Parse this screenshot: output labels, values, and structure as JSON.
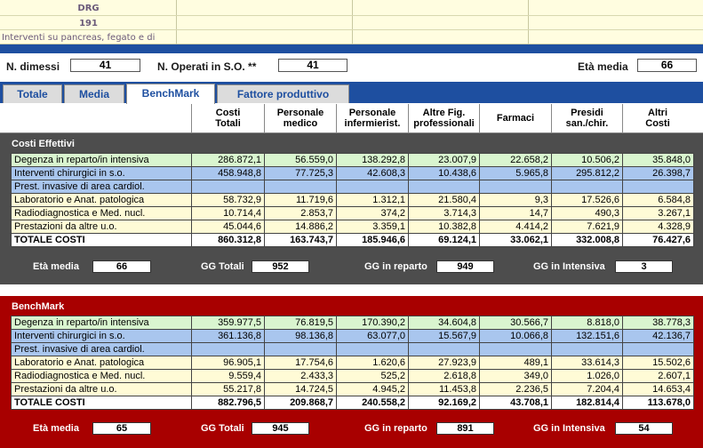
{
  "drg": {
    "title": "DRG",
    "code": "191",
    "description": "Interventi su pancreas, fegato e di"
  },
  "counters": {
    "dimessi_label": "N. dimessi",
    "dimessi_value": "41",
    "operati_label": "N. Operati in S.O. **",
    "operati_value": "41",
    "eta_label": "Età media",
    "eta_value": "66"
  },
  "tabs": [
    {
      "label": "Totale",
      "active": false
    },
    {
      "label": "Media",
      "active": false
    },
    {
      "label": "BenchMark",
      "active": true
    },
    {
      "label": "Fattore produttivo",
      "active": false
    }
  ],
  "columns": [
    "Costi\nTotali",
    "Personale\nmedico",
    "Personale\ninfermierist.",
    "Altre Fig.\nprofessionali",
    "Farmaci",
    "Presidi\nsan./chir.",
    "Altri\nCosti"
  ],
  "costi_effettivi": {
    "title": "Costi Effettivi",
    "rows": [
      {
        "name": "Degenza in reparto/in intensiva",
        "color": "green",
        "values": [
          "286.872,1",
          "56.559,0",
          "138.292,8",
          "23.007,9",
          "22.658,2",
          "10.506,2",
          "35.848,0"
        ]
      },
      {
        "name": "Interventi chirurgici in s.o.",
        "color": "blue",
        "values": [
          "458.948,8",
          "77.725,3",
          "42.608,3",
          "10.438,6",
          "5.965,8",
          "295.812,2",
          "26.398,7"
        ]
      },
      {
        "name": "Prest. invasive di area cardiol.",
        "color": "blue",
        "values": [
          "",
          "",
          "",
          "",
          "",
          "",
          ""
        ]
      },
      {
        "name": "Laboratorio e Anat. patologica",
        "color": "yellow",
        "values": [
          "58.732,9",
          "11.719,6",
          "1.312,1",
          "21.580,4",
          "9,3",
          "17.526,6",
          "6.584,8"
        ]
      },
      {
        "name": "Radiodiagnostica e Med. nucl.",
        "color": "yellow",
        "values": [
          "10.714,4",
          "2.853,7",
          "374,2",
          "3.714,3",
          "14,7",
          "490,3",
          "3.267,1"
        ]
      },
      {
        "name": "Prestazioni da altre u.o.",
        "color": "yellow",
        "values": [
          "45.044,6",
          "14.886,2",
          "3.359,1",
          "10.382,8",
          "4.414,2",
          "7.621,9",
          "4.328,9"
        ]
      },
      {
        "name": "TOTALE COSTI",
        "color": "total",
        "values": [
          "860.312,8",
          "163.743,7",
          "185.946,6",
          "69.124,1",
          "33.062,1",
          "332.008,8",
          "76.427,6"
        ]
      }
    ],
    "footer": {
      "eta_label": "Età media",
      "eta_value": "66",
      "gg_totali_label": "GG Totali",
      "gg_totali_value": "952",
      "gg_reparto_label": "GG in reparto",
      "gg_reparto_value": "949",
      "gg_intensiva_label": "GG in Intensiva",
      "gg_intensiva_value": "3"
    }
  },
  "benchmark": {
    "title": "BenchMark",
    "rows": [
      {
        "name": "Degenza in reparto/in intensiva",
        "color": "green",
        "values": [
          "359.977,5",
          "76.819,5",
          "170.390,2",
          "34.604,8",
          "30.566,7",
          "8.818,0",
          "38.778,3"
        ]
      },
      {
        "name": "Interventi chirurgici in s.o.",
        "color": "blue",
        "values": [
          "361.136,8",
          "98.136,8",
          "63.077,0",
          "15.567,9",
          "10.066,8",
          "132.151,6",
          "42.136,7"
        ]
      },
      {
        "name": "Prest. invasive di area cardiol.",
        "color": "blue",
        "values": [
          "",
          "",
          "",
          "",
          "",
          "",
          ""
        ]
      },
      {
        "name": "Laboratorio e Anat. patologica",
        "color": "yellow",
        "values": [
          "96.905,1",
          "17.754,6",
          "1.620,6",
          "27.923,9",
          "489,1",
          "33.614,3",
          "15.502,6"
        ]
      },
      {
        "name": "Radiodiagnostica e Med. nucl.",
        "color": "yellow",
        "values": [
          "9.559,4",
          "2.433,3",
          "525,2",
          "2.618,8",
          "349,0",
          "1.026,0",
          "2.607,1"
        ]
      },
      {
        "name": "Prestazioni da altre u.o.",
        "color": "yellow",
        "values": [
          "55.217,8",
          "14.724,5",
          "4.945,2",
          "11.453,8",
          "2.236,5",
          "7.204,4",
          "14.653,4"
        ]
      },
      {
        "name": "TOTALE COSTI",
        "color": "total",
        "values": [
          "882.796,5",
          "209.868,7",
          "240.558,2",
          "92.169,2",
          "43.708,1",
          "182.814,4",
          "113.678,0"
        ]
      }
    ],
    "footer": {
      "eta_label": "Età media",
      "eta_value": "65",
      "gg_totali_label": "GG Totali",
      "gg_totali_value": "945",
      "gg_reparto_label": "GG in reparto",
      "gg_reparto_value": "891",
      "gg_intensiva_label": "GG in Intensiva",
      "gg_intensiva_value": "54"
    }
  }
}
